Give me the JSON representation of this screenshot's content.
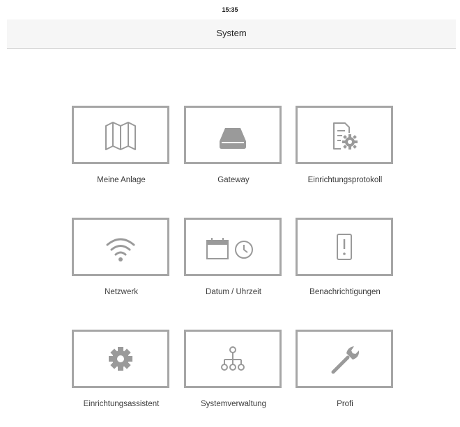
{
  "status_bar": {
    "time": "15:35"
  },
  "nav": {
    "title": "System"
  },
  "tiles": [
    {
      "label": "Meine Anlage",
      "icon": "map-icon"
    },
    {
      "label": "Gateway",
      "icon": "gateway-icon"
    },
    {
      "label": "Einrichtungsprotokoll",
      "icon": "protocol-gear-icon"
    },
    {
      "label": "Netzwerk",
      "icon": "wifi-icon"
    },
    {
      "label": "Datum / Uhrzeit",
      "icon": "calendar-clock-icon"
    },
    {
      "label": "Benachrichtigungen",
      "icon": "notification-icon"
    },
    {
      "label": "Einrichtungsassistent",
      "icon": "gear-icon"
    },
    {
      "label": "Systemverwaltung",
      "icon": "hierarchy-icon"
    },
    {
      "label": "Profi",
      "icon": "wrench-icon"
    }
  ],
  "colors": {
    "tile_border": "#a6a6a6",
    "icon": "#9a9a9a",
    "nav_background": "#f6f6f6"
  }
}
